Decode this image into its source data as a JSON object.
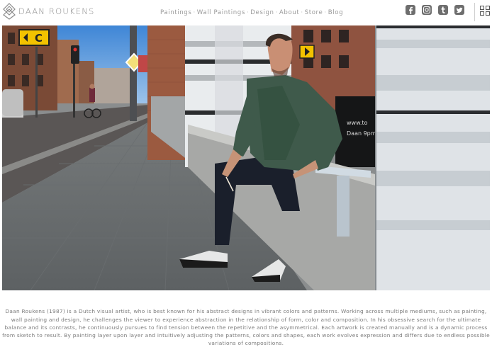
{
  "brand": {
    "name": "DAAN ROUKENS"
  },
  "nav": {
    "items": [
      {
        "label": "Paintings"
      },
      {
        "label": "Wall Paintings"
      },
      {
        "label": "Design"
      },
      {
        "label": "About"
      },
      {
        "label": "Store"
      },
      {
        "label": "Blog"
      }
    ],
    "separator": "·"
  },
  "social": [
    "facebook-icon",
    "instagram-icon",
    "tumblr-icon",
    "twitter-icon"
  ],
  "colors": {
    "nav_text": "#9b9b9b",
    "icon": "#6e6e6e",
    "bio_text": "#7a7a7a"
  },
  "bio": {
    "text": "Daan Roukens (1987) is a Dutch visual artist, who is best known for his abstract designs in vibrant colors and patterns. Working across multiple mediums, such as painting, wall painting and design, he challenges the viewer to experience abstraction in the relationship of form, color and composition. In his obsessive search for the ultimate balance and its contrasts, he continuously pursues to find tension between the repetitive and the asymmetrical. Each artwork is created manually and is a dynamic process from sketch to result. By painting layer upon layer and intuitively adjusting the patterns, colors and shapes, each work evolves expression and differs due to endless possible variations of compositions."
  },
  "hero": {
    "sign_letter": "C",
    "window_text_1": "www.to",
    "window_text_2": "Daan 9pm"
  }
}
